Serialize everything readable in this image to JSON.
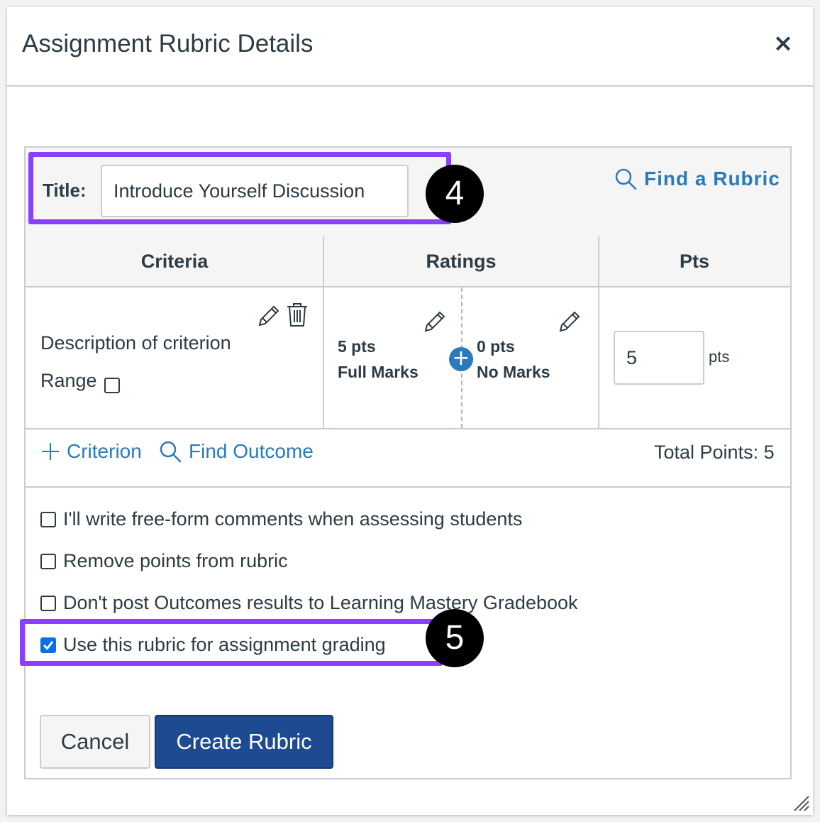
{
  "dialog": {
    "title": "Assignment Rubric Details",
    "close_label": "×"
  },
  "rubric": {
    "title_label": "Title:",
    "title_value": "Introduce Yourself Discussion",
    "find_rubric": "Find a Rubric",
    "columns": {
      "criteria": "Criteria",
      "ratings": "Ratings",
      "pts": "Pts"
    },
    "criterion": {
      "description": "Description of criterion",
      "range_label": "Range",
      "ratings": [
        {
          "points": "5 pts",
          "label": "Full Marks"
        },
        {
          "points": "0 pts",
          "label": "No Marks"
        }
      ],
      "points_value": "5",
      "points_unit": "pts"
    },
    "add_criterion": "Criterion",
    "find_outcome": "Find Outcome",
    "total_points": "Total Points: 5"
  },
  "options": [
    {
      "label": "I'll write free-form comments when assessing students",
      "checked": false
    },
    {
      "label": "Remove points from rubric",
      "checked": false
    },
    {
      "label": "Don't post Outcomes results to Learning Mastery Gradebook",
      "checked": false
    },
    {
      "label": "Use this rubric for assignment grading",
      "checked": true
    }
  ],
  "buttons": {
    "cancel": "Cancel",
    "create": "Create Rubric"
  },
  "callouts": {
    "step_title": "4",
    "step_grading": "5"
  },
  "colors": {
    "accent_purple": "#8a3ffc",
    "link_blue": "#2b7abc",
    "primary_button": "#1d4a91",
    "checkbox_blue": "#0770e4"
  }
}
